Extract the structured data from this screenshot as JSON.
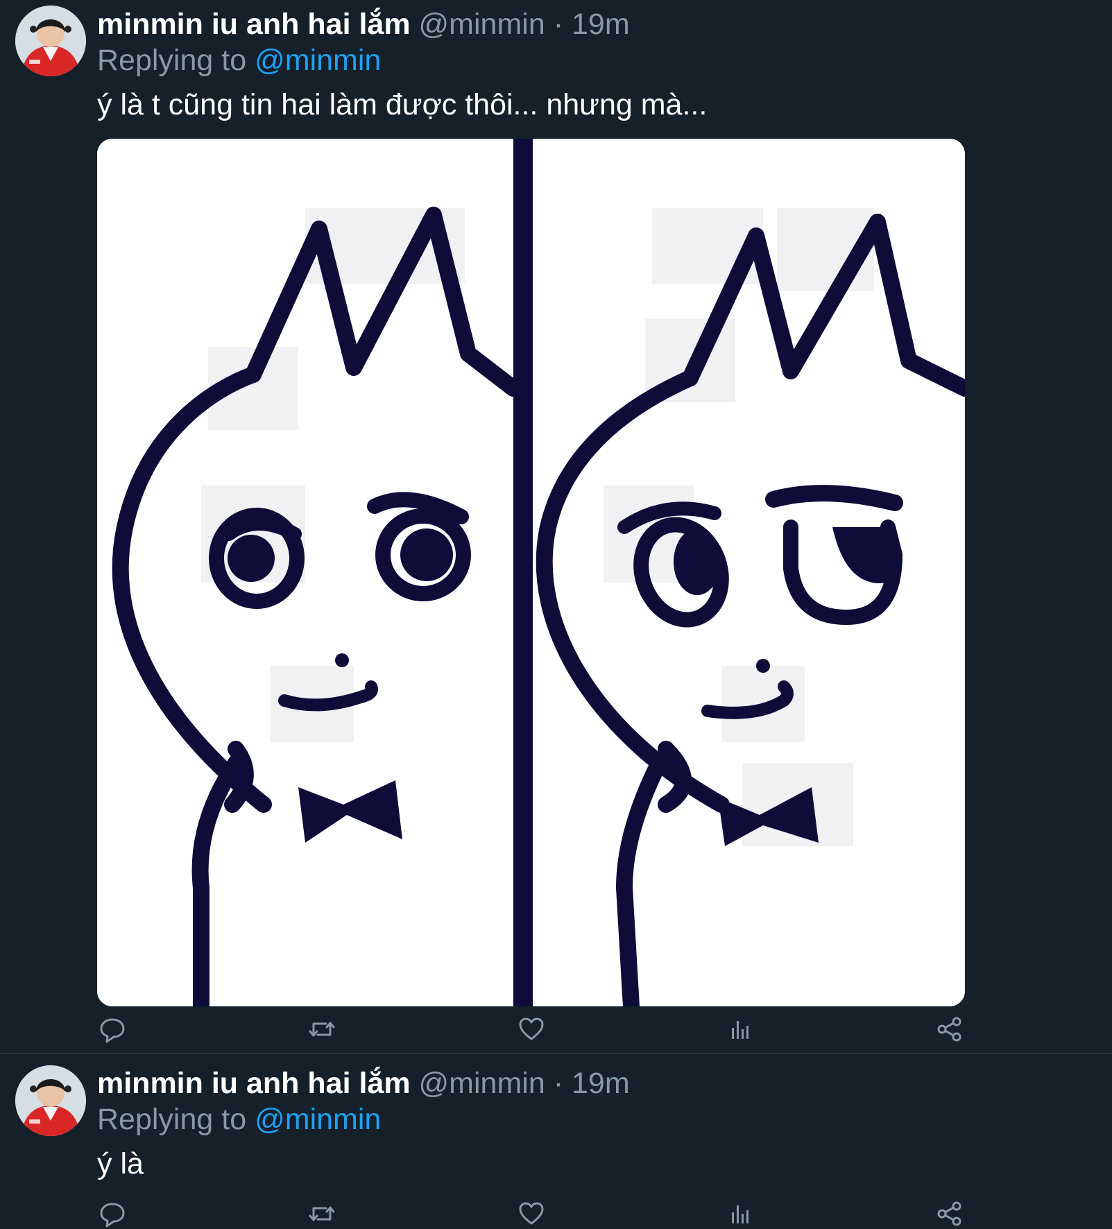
{
  "tweets": [
    {
      "display_name": "minmin iu anh hai lắm",
      "handle": "@minmin",
      "separator": "·",
      "time": "19m",
      "replying_prefix": "Replying to",
      "replying_to": "@minmin",
      "text": "ý là t cũng tin hai làm được thôi... nhưng mà...",
      "has_media": true,
      "media_description_icon": "cartoon-cat-meme-image"
    },
    {
      "display_name": "minmin iu anh hai lắm",
      "handle": "@minmin",
      "separator": "·",
      "time": "19m",
      "replying_prefix": "Replying to",
      "replying_to": "@minmin",
      "text": "ý là",
      "has_media": false
    }
  ],
  "action_icons": [
    "reply-icon",
    "retweet-icon",
    "like-icon",
    "analytics-icon",
    "share-icon"
  ],
  "colors": {
    "background": "#15202b",
    "primary_text": "#ffffff",
    "secondary_text": "#8899a6",
    "link": "#1da1f2",
    "divider": "#38444d",
    "ink": "#0f0c3a"
  }
}
